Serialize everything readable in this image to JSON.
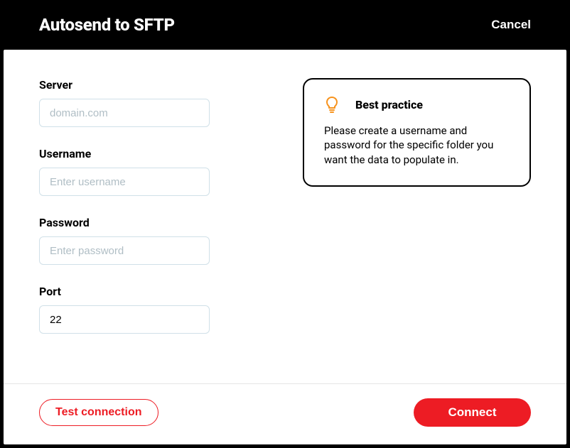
{
  "header": {
    "title": "Autosend to SFTP",
    "cancel": "Cancel"
  },
  "form": {
    "server": {
      "label": "Server",
      "placeholder": "domain.com",
      "value": ""
    },
    "username": {
      "label": "Username",
      "placeholder": "Enter username",
      "value": ""
    },
    "password": {
      "label": "Password",
      "placeholder": "Enter password",
      "value": ""
    },
    "port": {
      "label": "Port",
      "placeholder": "",
      "value": "22"
    }
  },
  "info": {
    "title": "Best practice",
    "body": "Please create a username and password for the specific folder you want the data to populate in."
  },
  "footer": {
    "test": "Test connection",
    "connect": "Connect"
  },
  "colors": {
    "accent": "#ed1c24",
    "iconStroke": "#f7931e"
  }
}
